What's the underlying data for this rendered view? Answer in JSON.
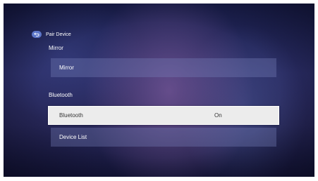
{
  "header": {
    "back_icon": "back-arrow-icon",
    "title": "Pair Device"
  },
  "sections": [
    {
      "label": "Mirror",
      "items": [
        {
          "label": "Mirror",
          "value": ""
        }
      ]
    },
    {
      "label": "Bluetooth",
      "items": [
        {
          "label": "Bluetooth",
          "value": "On",
          "selected": true
        },
        {
          "label": "Device List",
          "value": ""
        }
      ]
    }
  ],
  "colors": {
    "background": "#262656",
    "item_background": "#6e78a8",
    "selected_background": "#ececec",
    "selected_text": "#333333",
    "back_icon": "#5e77c9"
  }
}
